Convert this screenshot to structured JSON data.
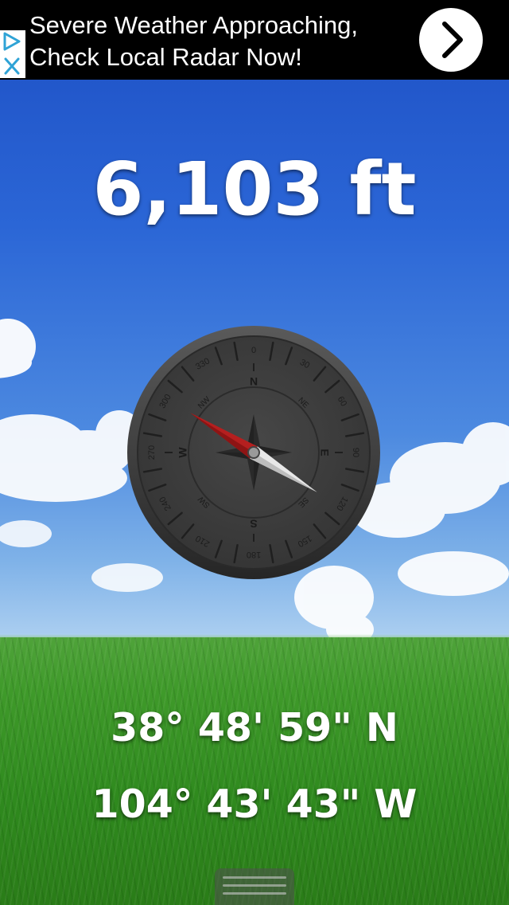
{
  "ad": {
    "line1": "Severe Weather Approaching,",
    "line2": "Check Local Radar Now!",
    "choices_icon": "adchoices-icon",
    "arrow_icon": "chevron-right-icon"
  },
  "altitude": {
    "value": "6,103 ft"
  },
  "compass": {
    "bearing_labels": [
      "0",
      "30",
      "60",
      "90",
      "120",
      "150",
      "180",
      "210",
      "240",
      "270",
      "300",
      "330"
    ],
    "cardinals": [
      "N",
      "E",
      "S",
      "W"
    ],
    "intercardinals": [
      "NE",
      "SE",
      "SW",
      "NW"
    ],
    "needle_heading_deg": 302,
    "colors": {
      "face": "#3a3a3a",
      "needle_north": "#b51f1f",
      "needle_south": "#e8e8e8"
    }
  },
  "location": {
    "latitude": "38° 48' 59\" N",
    "longitude": "104° 43' 43\" W"
  },
  "drawer": {
    "icon": "drawer-handle-icon"
  }
}
